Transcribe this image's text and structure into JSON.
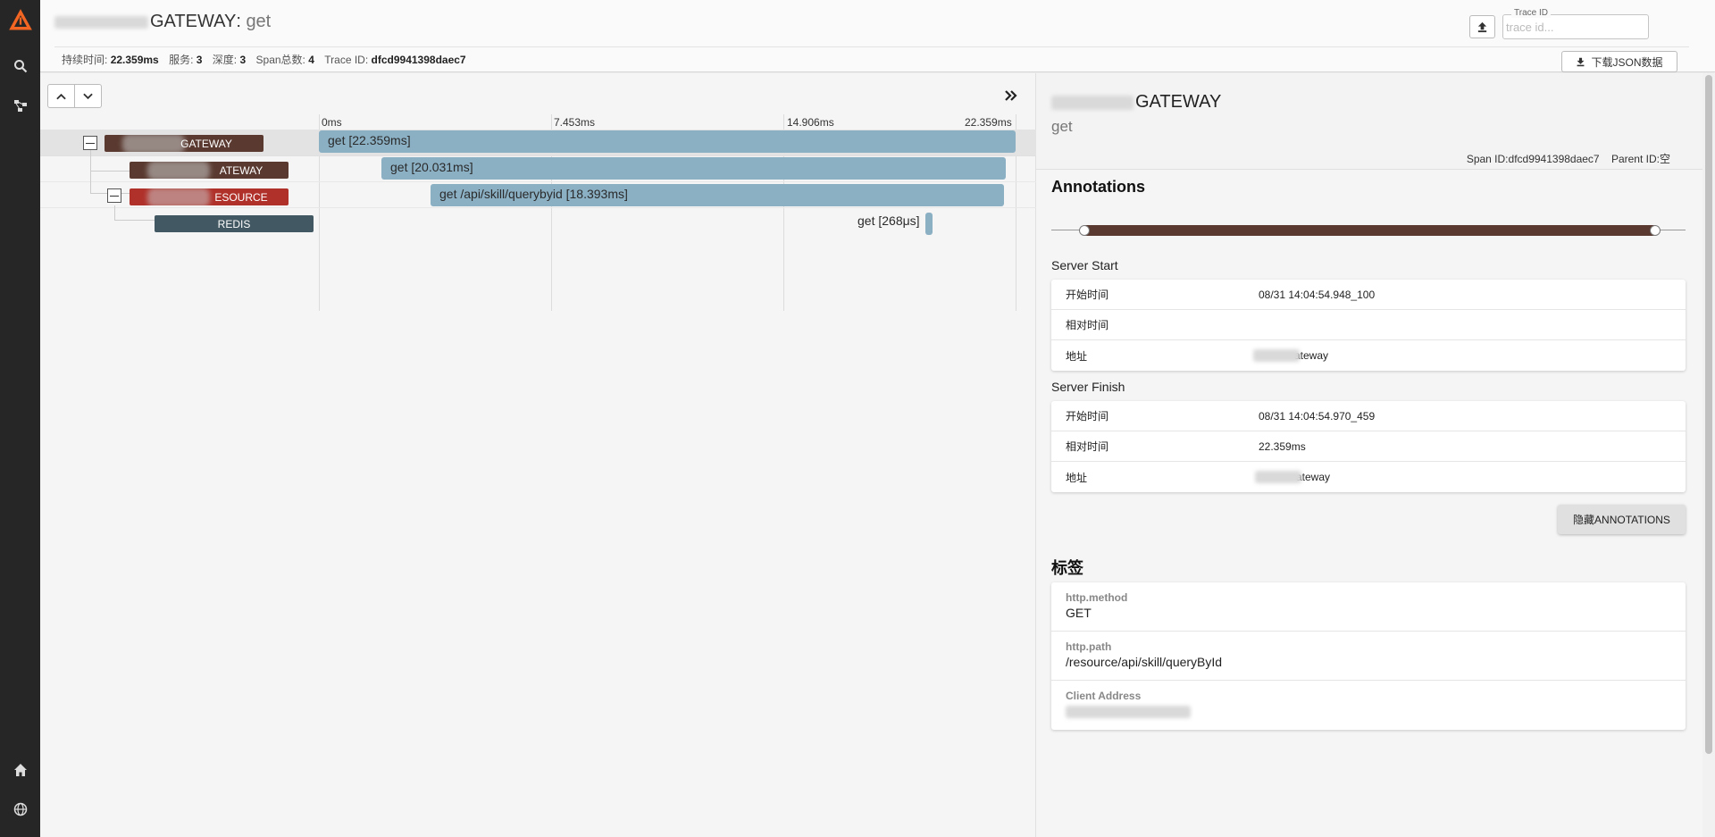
{
  "app": {
    "brand_color": "#f26522",
    "nav_bg": "#262626"
  },
  "nav": {
    "items": [
      {
        "name": "logo",
        "icon": "zipkin-logo-icon"
      },
      {
        "name": "search",
        "icon": "search-icon"
      },
      {
        "name": "dependencies",
        "icon": "dependency-graph-icon"
      },
      {
        "name": "home",
        "icon": "home-icon"
      },
      {
        "name": "language",
        "icon": "globe-icon"
      }
    ]
  },
  "header": {
    "service_suffix": "GATEWAY",
    "separator": ": ",
    "operation": "get",
    "stats": {
      "duration_label": "持续时间:",
      "duration": "22.359ms",
      "services_label": "服务:",
      "services": "3",
      "depth_label": "深度:",
      "depth": "3",
      "spans_label": "Span总数:",
      "spans": "4",
      "traceid_label": "Trace ID:",
      "traceid": "dfcd9941398daec7"
    },
    "trace_id_field": {
      "label": "Trace ID",
      "placeholder": "trace id..."
    },
    "download_label": "下载JSON数据"
  },
  "timeline": {
    "ticks": [
      "0ms",
      "7.453ms",
      "14.906ms",
      "22.359ms"
    ],
    "spans": [
      {
        "service": "GATEWAY",
        "label": "get [22.359ms]",
        "color": "#5a3a30",
        "selected": true,
        "depth": 0
      },
      {
        "service": "ATEWAY",
        "label": "get [20.031ms]",
        "color": "#5a3a30",
        "selected": false,
        "depth": 1
      },
      {
        "service": "ESOURCE",
        "label": "get /api/skill/querybyid [18.393ms]",
        "color": "#b0302a",
        "selected": false,
        "depth": 1
      },
      {
        "service": "REDIS",
        "label": "get [268μs]",
        "color": "#425862",
        "selected": false,
        "depth": 2
      }
    ]
  },
  "detail": {
    "service_suffix": "GATEWAY",
    "operation": "get",
    "span_id_label": "Span ID:",
    "span_id": "dfcd9941398daec7",
    "parent_id_label": "Parent ID:",
    "parent_id": "空",
    "annotations_title": "Annotations",
    "server_start": {
      "title": "Server Start",
      "rows": [
        {
          "key": "开始时间",
          "value": "08/31 14:04:54.948_100"
        },
        {
          "key": "相对时间",
          "value": ""
        },
        {
          "key": "地址",
          "value": "ateway"
        }
      ]
    },
    "server_finish": {
      "title": "Server Finish",
      "rows": [
        {
          "key": "开始时间",
          "value": "08/31 14:04:54.970_459"
        },
        {
          "key": "相对时间",
          "value": "22.359ms"
        },
        {
          "key": "地址",
          "value": "ateway"
        }
      ]
    },
    "hide_annotations_label": "隐藏ANNOTATIONS",
    "tags_title": "标签",
    "tags": [
      {
        "key": "http.method",
        "value": "GET"
      },
      {
        "key": "http.path",
        "value": "/resource/api/skill/queryById"
      },
      {
        "key": "Client Address",
        "value": ""
      }
    ]
  }
}
